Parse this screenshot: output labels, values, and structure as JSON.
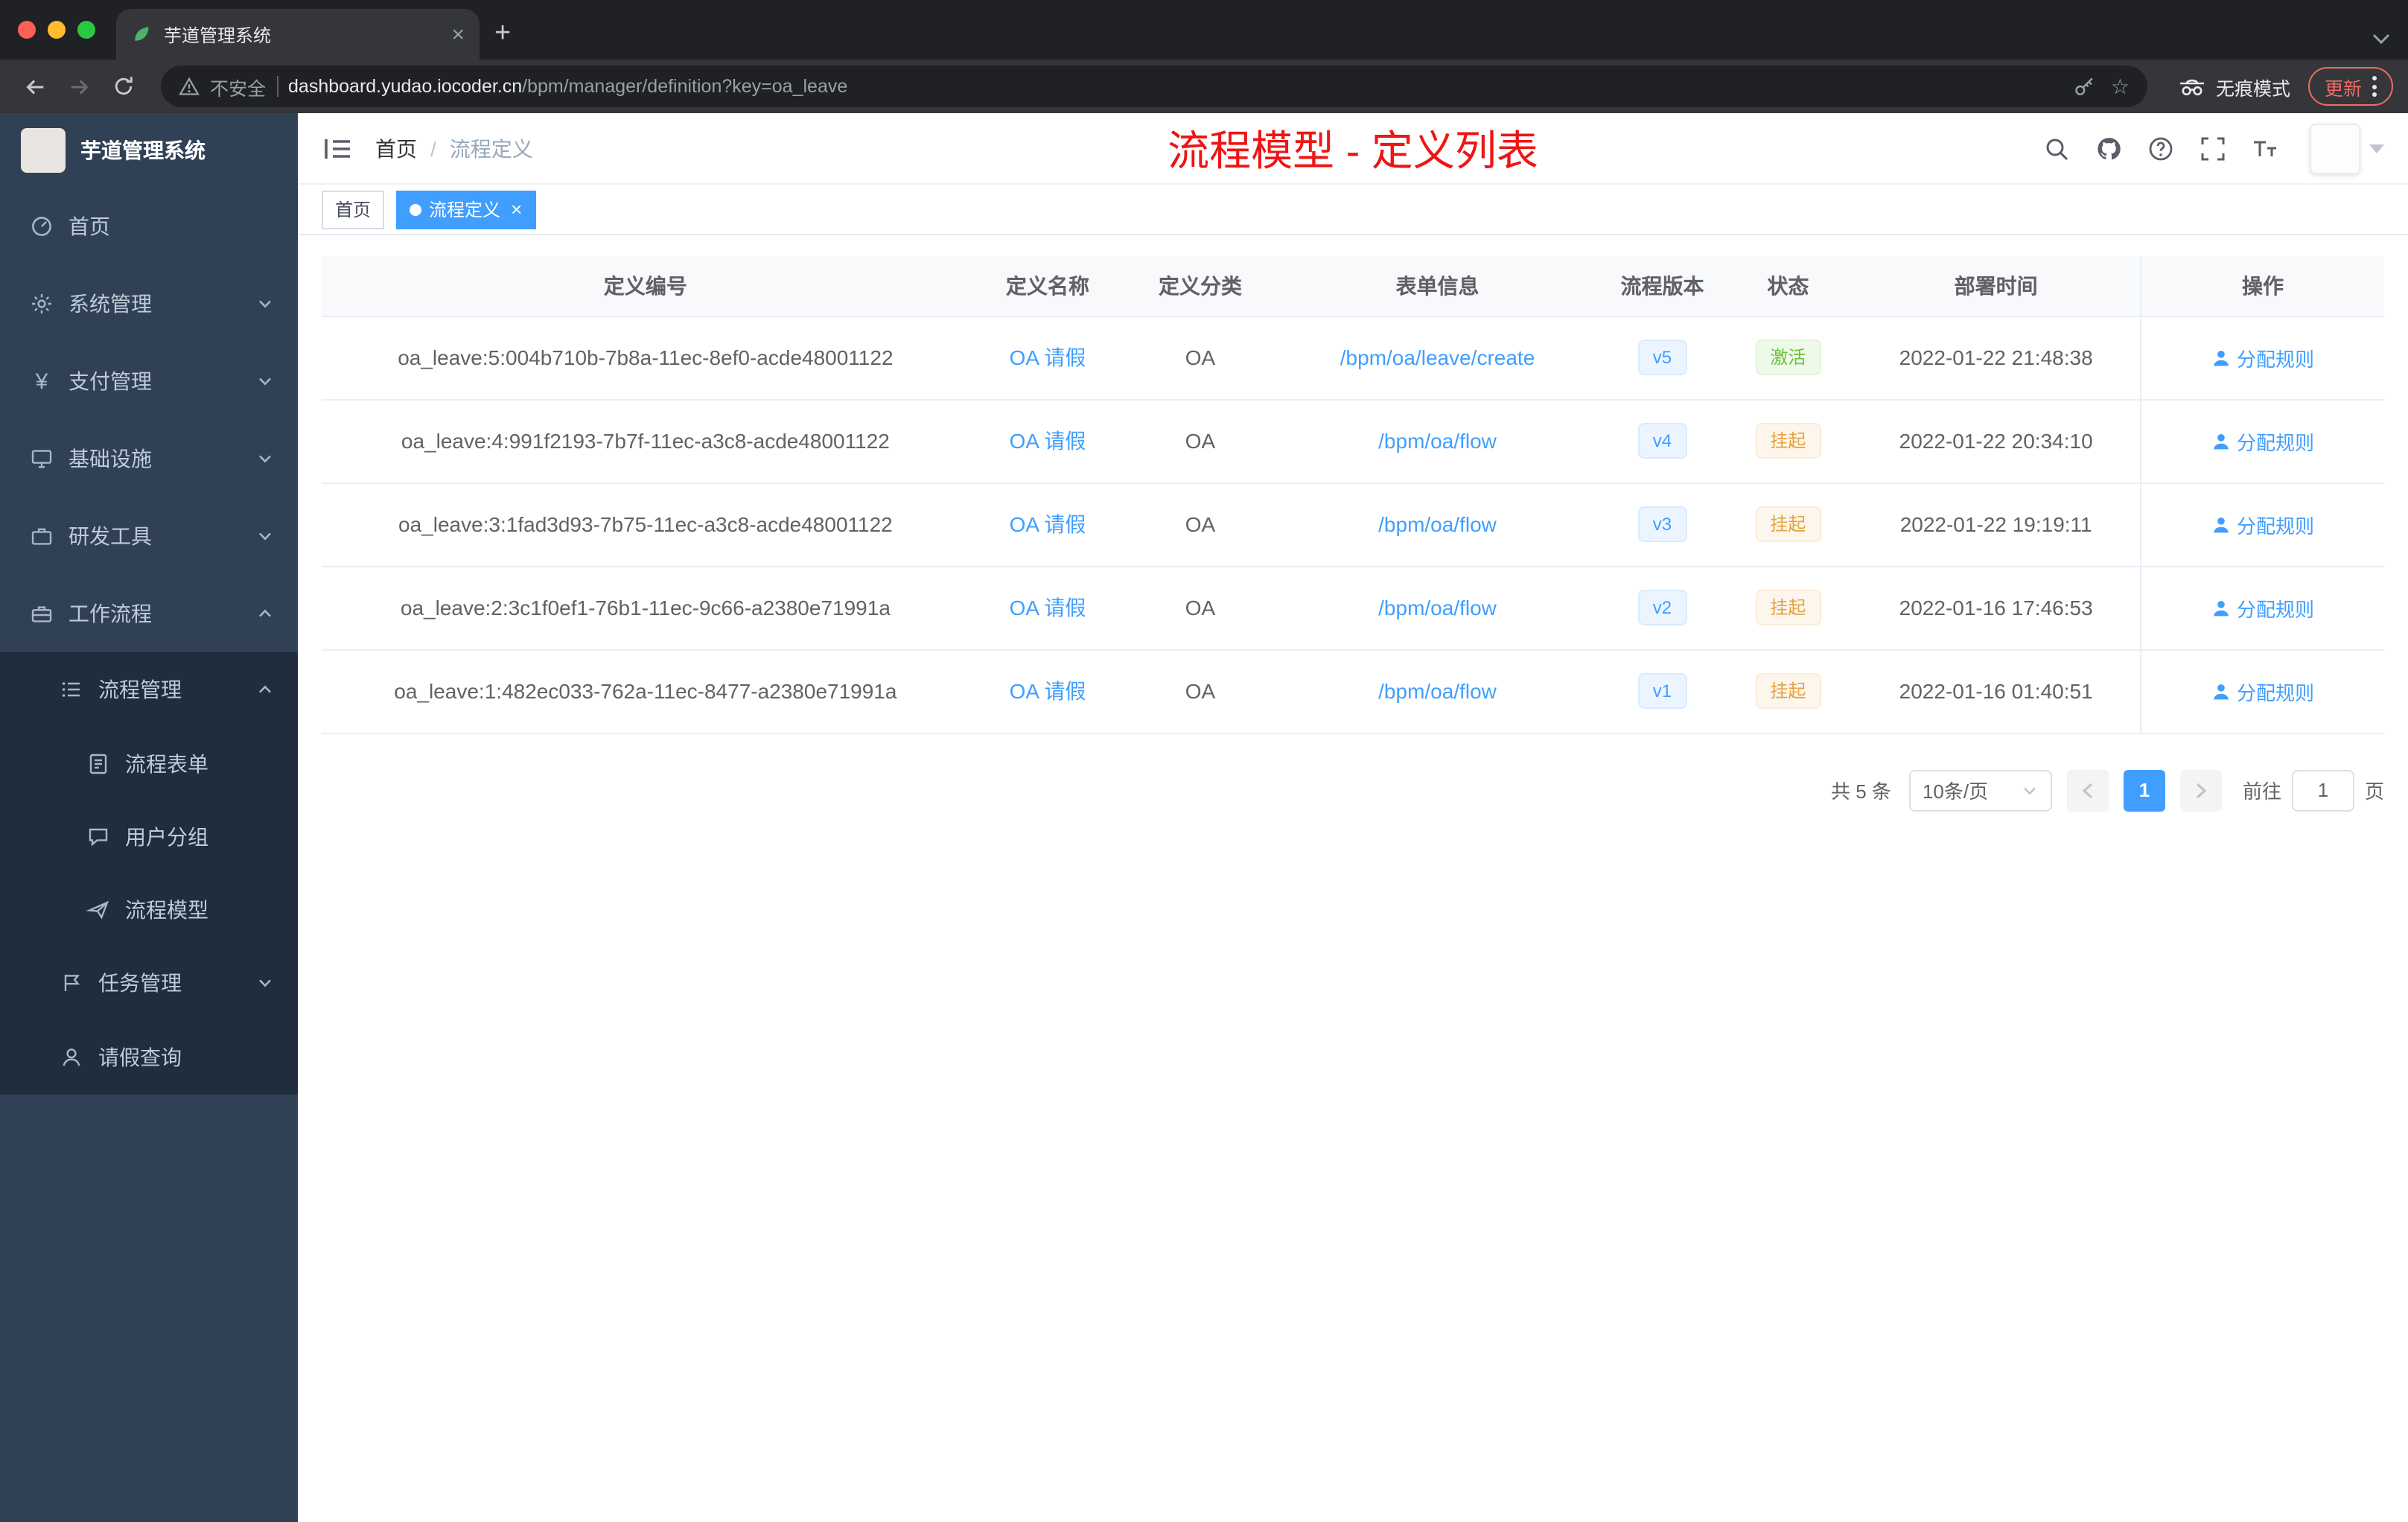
{
  "browser": {
    "tab_title": "芋道管理系统",
    "security_label": "不安全",
    "url_host": "dashboard.yudao.iocoder.cn",
    "url_path": "/bpm/manager/definition?key=oa_leave",
    "incognito_label": "无痕模式",
    "update_label": "更新"
  },
  "icons": {
    "tab_close": "×",
    "new_tab": "+",
    "bookmark_star": "☆",
    "tag_close": "×",
    "yen": "¥"
  },
  "sidebar": {
    "title": "芋道管理系统",
    "items": [
      {
        "label": "首页"
      },
      {
        "label": "系统管理"
      },
      {
        "label": "支付管理"
      },
      {
        "label": "基础设施"
      },
      {
        "label": "研发工具"
      },
      {
        "label": "工作流程"
      }
    ],
    "workflow_children": [
      {
        "label": "流程管理"
      },
      {
        "label": "任务管理"
      },
      {
        "label": "请假查询"
      }
    ],
    "process_children": [
      {
        "label": "流程表单"
      },
      {
        "label": "用户分组"
      },
      {
        "label": "流程模型"
      }
    ]
  },
  "header": {
    "breadcrumb": [
      "首页",
      "流程定义"
    ],
    "separator": "/",
    "caption": "流程模型 - 定义列表"
  },
  "tags": [
    {
      "label": "首页",
      "active": false
    },
    {
      "label": "流程定义",
      "active": true
    }
  ],
  "table": {
    "columns": [
      "定义编号",
      "定义名称",
      "定义分类",
      "表单信息",
      "流程版本",
      "状态",
      "部署时间",
      "操作"
    ],
    "rows": [
      {
        "id": "oa_leave:5:004b710b-7b8a-11ec-8ef0-acde48001122",
        "name": "OA 请假",
        "category": "OA",
        "form": "/bpm/oa/leave/create",
        "version": "v5",
        "status": "激活",
        "status_type": "success",
        "deployed": "2022-01-22 21:48:38",
        "action": "分配规则"
      },
      {
        "id": "oa_leave:4:991f2193-7b7f-11ec-a3c8-acde48001122",
        "name": "OA 请假",
        "category": "OA",
        "form": "/bpm/oa/flow",
        "version": "v4",
        "status": "挂起",
        "status_type": "warning",
        "deployed": "2022-01-22 20:34:10",
        "action": "分配规则"
      },
      {
        "id": "oa_leave:3:1fad3d93-7b75-11ec-a3c8-acde48001122",
        "name": "OA 请假",
        "category": "OA",
        "form": "/bpm/oa/flow",
        "version": "v3",
        "status": "挂起",
        "status_type": "warning",
        "deployed": "2022-01-22 19:19:11",
        "action": "分配规则"
      },
      {
        "id": "oa_leave:2:3c1f0ef1-76b1-11ec-9c66-a2380e71991a",
        "name": "OA 请假",
        "category": "OA",
        "form": "/bpm/oa/flow",
        "version": "v2",
        "status": "挂起",
        "status_type": "warning",
        "deployed": "2022-01-16 17:46:53",
        "action": "分配规则"
      },
      {
        "id": "oa_leave:1:482ec033-762a-11ec-8477-a2380e71991a",
        "name": "OA 请假",
        "category": "OA",
        "form": "/bpm/oa/flow",
        "version": "v1",
        "status": "挂起",
        "status_type": "warning",
        "deployed": "2022-01-16 01:40:51",
        "action": "分配规则"
      }
    ]
  },
  "pagination": {
    "total_label": "共 5 条",
    "page_size": "10条/页",
    "current_page": "1",
    "goto_label": "前往",
    "goto_value": "1",
    "page_unit": "页"
  },
  "colors": {
    "accent": "#409eff",
    "success": "#67c23a",
    "warning": "#e6a23c",
    "caption_red": "#f01414",
    "sidebar_bg": "#304156",
    "submenu_bg": "#1f2d3d"
  }
}
